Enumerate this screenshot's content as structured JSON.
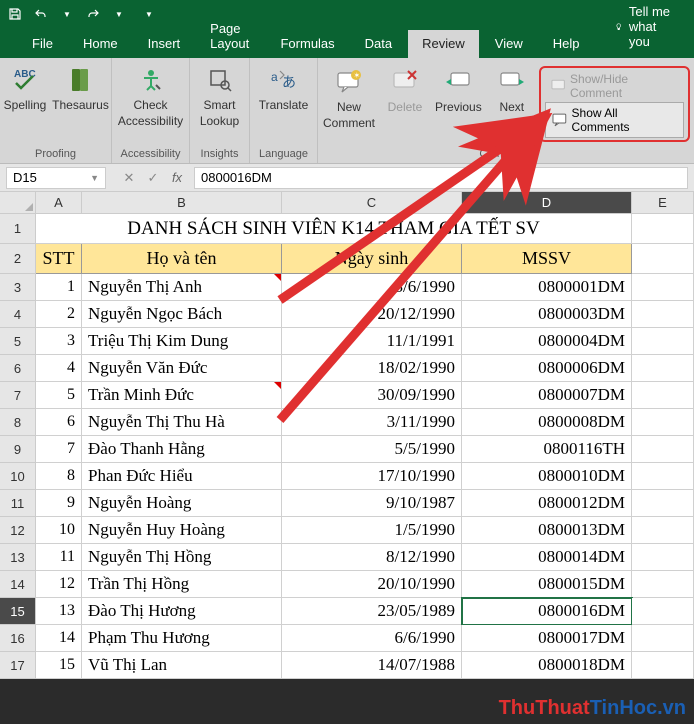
{
  "titlebar": {
    "icons": [
      "save",
      "undo",
      "redo"
    ]
  },
  "tabs": {
    "items": [
      "File",
      "Home",
      "Insert",
      "Page Layout",
      "Formulas",
      "Data",
      "Review",
      "View",
      "Help"
    ],
    "active": "Review",
    "tellme": "Tell me what you"
  },
  "ribbon": {
    "proofing": {
      "label": "Proofing",
      "spelling": "Spelling",
      "thesaurus": "Thesaurus"
    },
    "accessibility": {
      "label": "Accessibility",
      "check_l1": "Check",
      "check_l2": "Accessibility"
    },
    "insights": {
      "label": "Insights",
      "smart_l1": "Smart",
      "smart_l2": "Lookup"
    },
    "language": {
      "label": "Language",
      "translate": "Translate"
    },
    "comments": {
      "label": "Comments",
      "new_l1": "New",
      "new_l2": "Comment",
      "delete": "Delete",
      "previous": "Previous",
      "next": "Next",
      "showhide": "Show/Hide Comment",
      "showall": "Show All Comments"
    }
  },
  "formula_bar": {
    "namebox": "D15",
    "value": "0800016DM"
  },
  "grid": {
    "cols": [
      "A",
      "B",
      "C",
      "D",
      "E"
    ],
    "selected_col": "D",
    "title": "DANH SÁCH SINH VIÊN K14 THAM GIA TẾT SV",
    "headers": {
      "stt": "STT",
      "name": "Họ và tên",
      "date": "Ngày sinh",
      "mssv": "MSSV"
    },
    "rows": [
      {
        "n": 1,
        "name": "Nguyễn Thị Anh",
        "date": "3/6/1990",
        "mssv": "0800001DM",
        "cm": true
      },
      {
        "n": 2,
        "name": "Nguyễn Ngọc Bách",
        "date": "20/12/1990",
        "mssv": "0800003DM"
      },
      {
        "n": 3,
        "name": "Triệu Thị Kim Dung",
        "date": "11/1/1991",
        "mssv": "0800004DM"
      },
      {
        "n": 4,
        "name": "Nguyễn Văn Đức",
        "date": "18/02/1990",
        "mssv": "0800006DM"
      },
      {
        "n": 5,
        "name": "Trần Minh Đức",
        "date": "30/09/1990",
        "mssv": "0800007DM",
        "cm": true
      },
      {
        "n": 6,
        "name": "Nguyễn Thị Thu Hà",
        "date": "3/11/1990",
        "mssv": "0800008DM"
      },
      {
        "n": 7,
        "name": "Đào Thanh Hằng",
        "date": "5/5/1990",
        "mssv": "0800116TH"
      },
      {
        "n": 8,
        "name": "Phan Đức Hiểu",
        "date": "17/10/1990",
        "mssv": "0800010DM"
      },
      {
        "n": 9,
        "name": "Nguyễn Hoàng",
        "date": "9/10/1987",
        "mssv": "0800012DM"
      },
      {
        "n": 10,
        "name": "Nguyễn Huy Hoàng",
        "date": "1/5/1990",
        "mssv": "0800013DM"
      },
      {
        "n": 11,
        "name": "Nguyễn Thị Hồng",
        "date": "8/12/1990",
        "mssv": "0800014DM"
      },
      {
        "n": 12,
        "name": "Trần Thị Hồng",
        "date": "20/10/1990",
        "mssv": "0800015DM"
      },
      {
        "n": 13,
        "name": "Đào Thị Hương",
        "date": "23/05/1989",
        "mssv": "0800016DM"
      },
      {
        "n": 14,
        "name": "Phạm Thu Hương",
        "date": "6/6/1990",
        "mssv": "0800017DM"
      },
      {
        "n": 15,
        "name": "Vũ Thị Lan",
        "date": "14/07/1988",
        "mssv": "0800018DM"
      }
    ],
    "selected_row": 15
  },
  "watermark": {
    "p1": "ThuThuat",
    "p2": "TinHoc.vn"
  }
}
